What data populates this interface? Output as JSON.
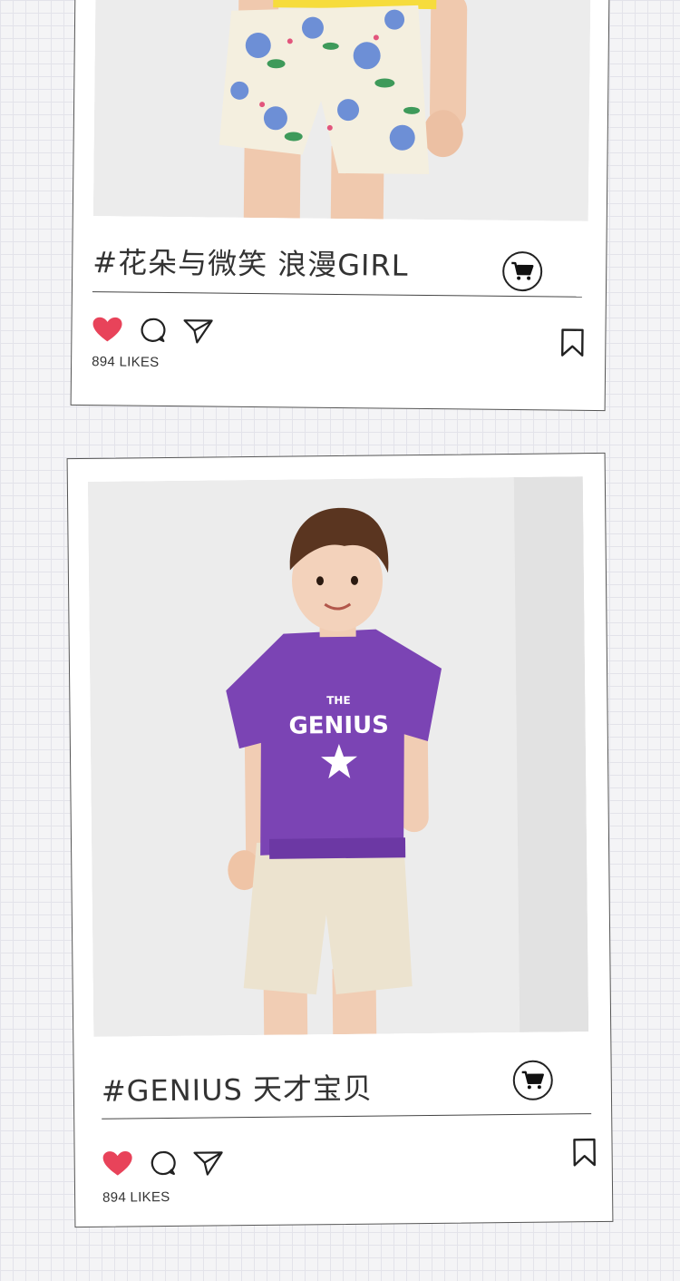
{
  "theme": {
    "heart_color": "#e8435a",
    "accent": "#222222"
  },
  "posts": [
    {
      "caption": "#花朵与微笑  浪漫GIRL",
      "likes": "894 LIKES",
      "photo_subject": "child in floral shorts"
    },
    {
      "caption": "#GENIUS  天才宝贝",
      "likes": "894 LIKES",
      "photo_subject": "boy in purple t-shirt",
      "shirt_print": {
        "small": "THE",
        "big": "GENIUS"
      }
    }
  ],
  "icons": [
    "heart-icon",
    "comment-icon",
    "share-icon",
    "bookmark-icon",
    "cart-icon"
  ]
}
